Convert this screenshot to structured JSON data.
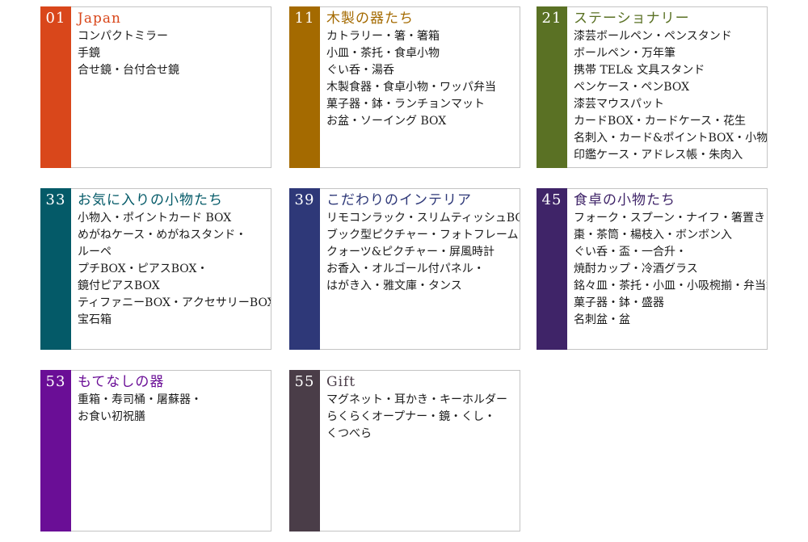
{
  "categories": [
    {
      "num": "01",
      "title": "Japan",
      "color": "#d9471b",
      "items": [
        "コンパクトミラー",
        "手鏡",
        "合せ鏡・台付合せ鏡"
      ]
    },
    {
      "num": "11",
      "title": "木製の器たち",
      "color": "#a46a00",
      "items": [
        "カトラリー・箸・箸箱",
        "小皿・茶托・食卓小物",
        "ぐい呑・湯呑",
        "木製食器・食卓小物・ワッパ弁当",
        "菓子器・鉢・ランチョンマット",
        "お盆・ソーイング BOX"
      ]
    },
    {
      "num": "21",
      "title": "ステーショナリー",
      "color": "#5a7124",
      "items": [
        "漆芸ボールペン・ペンスタンド",
        "ボールペン・万年筆",
        "携帯 TEL& 文具スタンド",
        "ペンケース・ペンBOX",
        "漆芸マウスパット",
        "カードBOX・カードケース・花生",
        "名刺入・カード&ポイントBOX・小物入",
        "印鑑ケース・アドレス帳・朱肉入"
      ]
    },
    {
      "num": "33",
      "title": "お気に入りの小物たち",
      "color": "#045a68",
      "items": [
        "小物入・ポイントカード BOX",
        "めがねケース・めがねスタンド・",
        "ルーペ",
        "プチBOX・ピアスBOX・",
        "鏡付ピアスBOX",
        "ティファニーBOX・アクセサリーBOX・",
        "宝石箱"
      ]
    },
    {
      "num": "39",
      "title": "こだわりのインテリア",
      "color": "#2e3878",
      "items": [
        "リモコンラック・スリムティッシュBOX",
        "ブック型ピクチャー・フォトフレーム",
        "クォーツ&ピクチャー・屏風時計",
        "お香入・オルゴール付パネル・",
        "はがき入・雅文庫・タンス"
      ]
    },
    {
      "num": "45",
      "title": "食卓の小物たち",
      "color": "#3f2468",
      "items": [
        "フォーク・スプーン・ナイフ・箸置き",
        "棗・茶筒・楊枝入・ボンボン入",
        "ぐい呑・盃・一合升・",
        "焼酎カップ・冷酒グラス",
        "銘々皿・茶托・小皿・小吸椀揃・弁当箱",
        "菓子器・鉢・盛器",
        "名刺盆・盆"
      ]
    },
    {
      "num": "53",
      "title": "もてなしの器",
      "color": "#6a0e96",
      "items": [
        "重箱・寿司桶・屠蘇器・",
        "お食い初祝膳"
      ]
    },
    {
      "num": "55",
      "title": "Gift",
      "color": "#4a3d48",
      "items": [
        "マグネット・耳かき・キーホルダー",
        "らくらくオープナー・鏡・くし・",
        "くつべら"
      ]
    }
  ]
}
